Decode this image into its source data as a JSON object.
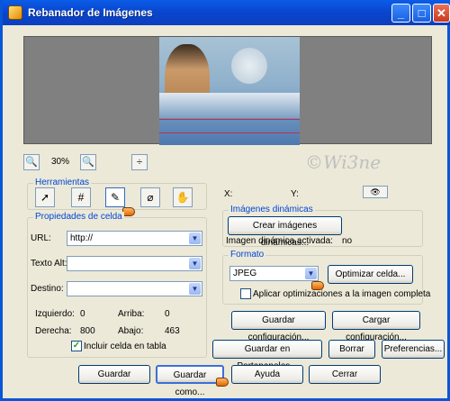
{
  "window": {
    "title": "Rebanador de Imágenes",
    "min": "_",
    "max": "□",
    "close": "✕"
  },
  "zoom": {
    "level": "30%",
    "zoom_in": "🔍",
    "zoom_out": "🔍",
    "fit": "÷"
  },
  "watermark": "©Wi3ne",
  "herramientas": {
    "legend": "Herramientas",
    "tools": [
      "pointer-tool-icon",
      "grid-tool-icon",
      "pen-tool-icon",
      "eraser-tool-icon",
      "hand-tool-icon"
    ]
  },
  "coords": {
    "x_label": "X:",
    "y_label": "Y:",
    "eye_icon": "👁"
  },
  "dinamicas": {
    "legend": "Imágenes dinámicas",
    "create_button": "Crear imágenes dinámicas...",
    "status_label": "Imagen dinámica activada:",
    "status_value": "no"
  },
  "celda": {
    "legend": "Propiedades de celda",
    "url_label": "URL:",
    "url_value": "http://",
    "alt_label": "Texto Alt:",
    "alt_value": "",
    "target_label": "Destino:",
    "target_value": "",
    "izq_label": "Izquierdo:",
    "izq_value": "0",
    "arriba_label": "Arriba:",
    "arriba_value": "0",
    "der_label": "Derecha:",
    "der_value": "800",
    "abajo_label": "Abajo:",
    "abajo_value": "463",
    "include_label": "Incluir celda en tabla"
  },
  "formato": {
    "legend": "Formato",
    "format_value": "JPEG",
    "optimize_button": "Optimizar celda...",
    "apply_label": "Aplicar optimizaciones a la imagen completa"
  },
  "config": {
    "save_button": "Guardar configuración...",
    "load_button": "Cargar configuración..."
  },
  "actions": {
    "clipboard": "Guardar en Portapapeles...",
    "delete": "Borrar",
    "prefs": "Preferencias..."
  },
  "footer": {
    "save": "Guardar",
    "save_as": "Guardar como...",
    "help": "Ayuda",
    "close": "Cerrar"
  }
}
